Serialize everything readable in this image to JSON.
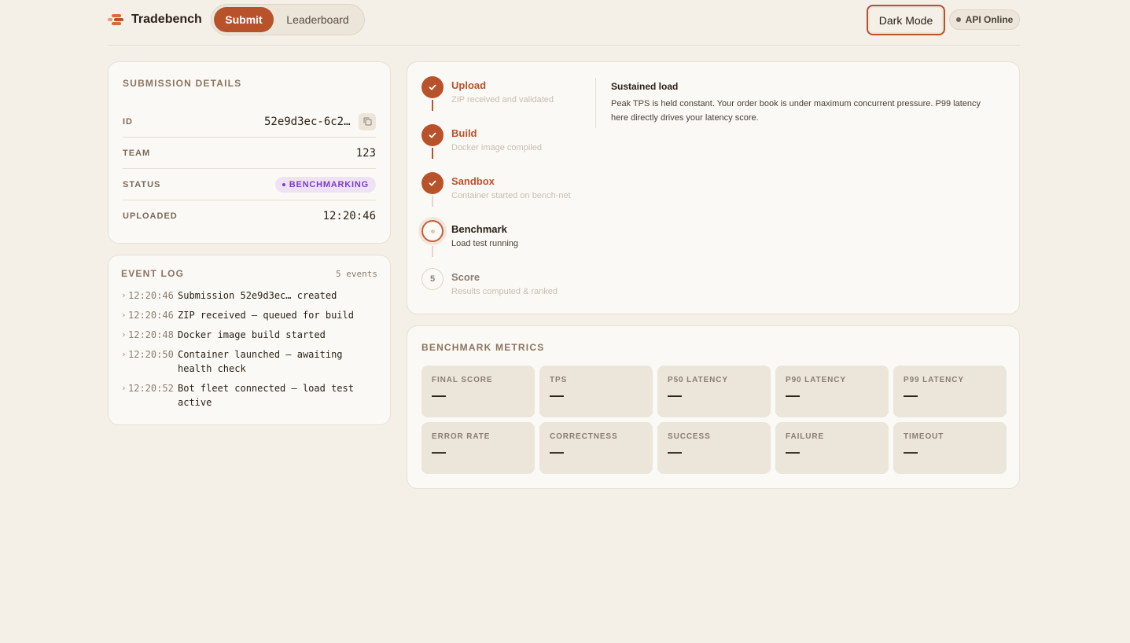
{
  "header": {
    "brand": "Tradebench",
    "nav": {
      "submit": "Submit",
      "leaderboard": "Leaderboard"
    },
    "dark_mode": "Dark Mode",
    "api_status": "API Online"
  },
  "details": {
    "title": "SUBMISSION DETAILS",
    "rows": {
      "id": {
        "label": "ID",
        "value": "52e9d3ec-6c2…"
      },
      "team": {
        "label": "TEAM",
        "value": "123"
      },
      "status": {
        "label": "STATUS",
        "value": "BENCHMARKING"
      },
      "uploaded": {
        "label": "UPLOADED",
        "value": "12:20:46"
      }
    }
  },
  "event_log": {
    "title": "EVENT LOG",
    "count": "5 events",
    "events": [
      {
        "time": "12:20:46",
        "message": "Submission 52e9d3ec… created"
      },
      {
        "time": "12:20:46",
        "message": "ZIP received — queued for build"
      },
      {
        "time": "12:20:48",
        "message": "Docker image build started"
      },
      {
        "time": "12:20:50",
        "message": "Container launched — awaiting health check"
      },
      {
        "time": "12:20:52",
        "message": "Bot fleet connected — load test active"
      }
    ]
  },
  "pipeline": {
    "steps": [
      {
        "title": "Upload",
        "subtitle": "ZIP received and validated",
        "state": "done"
      },
      {
        "title": "Build",
        "subtitle": "Docker image compiled",
        "state": "done"
      },
      {
        "title": "Sandbox",
        "subtitle": "Container started on bench-net",
        "state": "done"
      },
      {
        "title": "Benchmark",
        "subtitle": "Load test running",
        "state": "active"
      },
      {
        "title": "Score",
        "subtitle": "Results computed & ranked",
        "state": "pending",
        "number": "5"
      }
    ],
    "phase": {
      "title": "Sustained load",
      "description": "Peak TPS is held constant. Your order book is under maximum concurrent pressure. P99 latency here directly drives your latency score."
    }
  },
  "metrics": {
    "title": "BENCHMARK METRICS",
    "cells": [
      {
        "label": "FINAL SCORE",
        "value": "—"
      },
      {
        "label": "TPS",
        "value": "—"
      },
      {
        "label": "P50 LATENCY",
        "value": "—"
      },
      {
        "label": "P90 LATENCY",
        "value": "—"
      },
      {
        "label": "P99 LATENCY",
        "value": "—"
      },
      {
        "label": "ERROR RATE",
        "value": "—"
      },
      {
        "label": "CORRECTNESS",
        "value": "—"
      },
      {
        "label": "SUCCESS",
        "value": "—"
      },
      {
        "label": "FAILURE",
        "value": "—"
      },
      {
        "label": "TIMEOUT",
        "value": "—"
      }
    ]
  },
  "colors": {
    "accent": "#b8522a",
    "background": "#f4f0e8",
    "card": "#fbf9f5",
    "status_badge": "#7b3ec4"
  }
}
